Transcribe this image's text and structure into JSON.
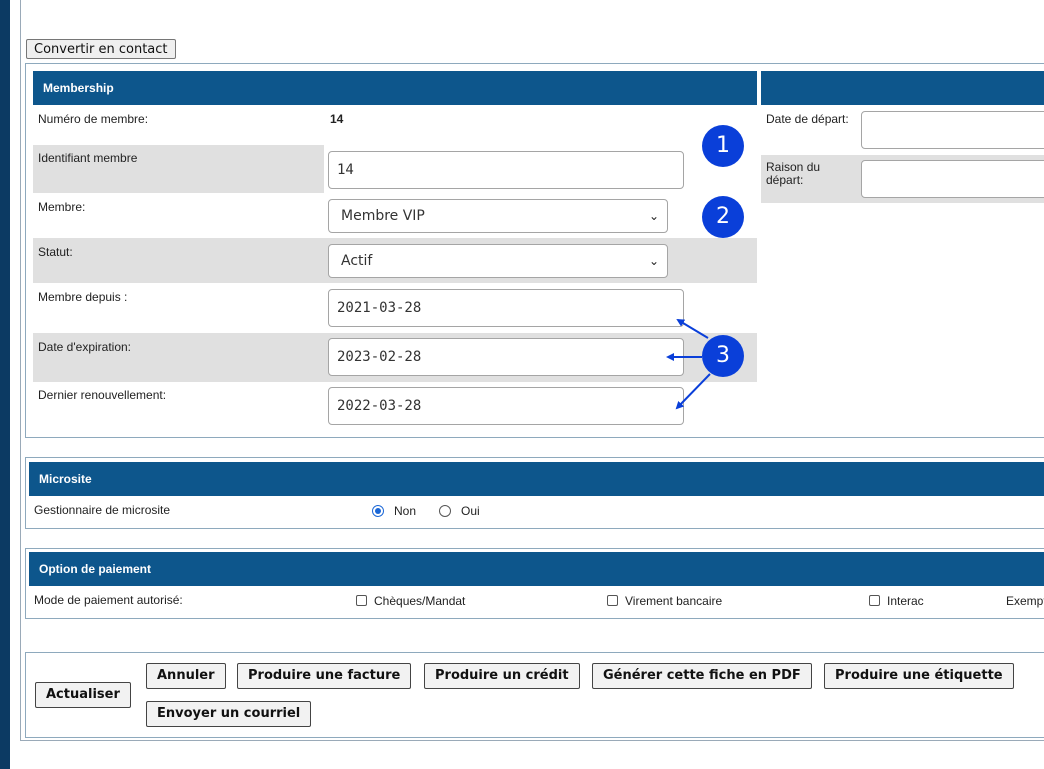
{
  "toolbar": {
    "convert_label": "Convertir en contact"
  },
  "membership": {
    "title": "Membership",
    "rows": [
      {
        "label": "Numéro de membre:",
        "value": "14"
      },
      {
        "label": "Identifiant membre",
        "value": "14"
      },
      {
        "label": "Membre:",
        "value": "Membre VIP"
      },
      {
        "label": "Statut:",
        "value": "Actif"
      },
      {
        "label": "Membre depuis :",
        "value": "2021-03-28"
      },
      {
        "label": "Date d'expiration:",
        "value": "2023-02-28"
      },
      {
        "label": "Dernier renouvellement:",
        "value": "2022-03-28"
      }
    ]
  },
  "departure": {
    "date_label": "Date de départ:",
    "reason_label": "Raison du départ:"
  },
  "annotations": {
    "one": "1",
    "two": "2",
    "three": "3",
    "accent": "#0a3fd9"
  },
  "microsite": {
    "title": "Microsite",
    "label": "Gestionnaire de microsite",
    "options": [
      "Non",
      "Oui"
    ],
    "selected": "Non"
  },
  "payment": {
    "title": "Option de paiement",
    "label": "Mode de paiement autorisé:",
    "options": [
      "Chèques/Mandat",
      "Virement bancaire",
      "Interac",
      "Exempt"
    ]
  },
  "actions": {
    "update": "Actualiser",
    "cancel": "Annuler",
    "invoice": "Produire une facture",
    "credit": "Produire un crédit",
    "pdf": "Générer cette fiche en PDF",
    "label": "Produire une étiquette",
    "email": "Envoyer un courriel"
  },
  "colors": {
    "header": "#0d568c",
    "row_alt": "#e0e0e0",
    "stripe": "#0c3a63"
  }
}
